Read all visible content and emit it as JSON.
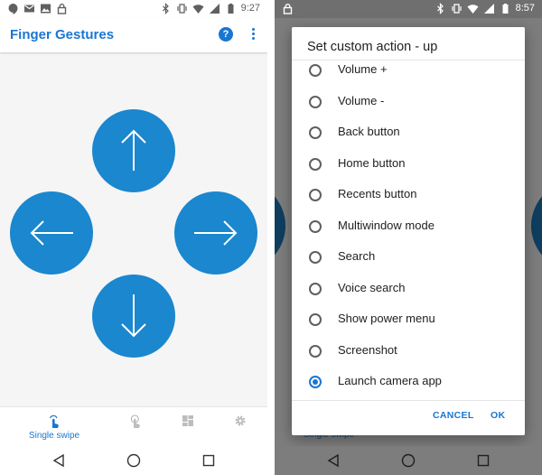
{
  "left_screen": {
    "status_bar": {
      "time": "9:27",
      "left_icons": [
        "hangouts-icon",
        "gmail-icon",
        "image-icon",
        "lock-icon"
      ],
      "right_icons": [
        "bluetooth-icon",
        "vibrate-icon",
        "wifi-icon",
        "signal-icon",
        "battery-icon"
      ]
    },
    "app_bar": {
      "title": "Finger Gestures",
      "icons": [
        "help-icon",
        "more-vert-icon"
      ]
    },
    "gesture_buttons": [
      "arrow-up-icon",
      "arrow-left-icon",
      "arrow-right-icon",
      "arrow-down-icon"
    ],
    "bottom_tabs": [
      {
        "label": "Single swipe",
        "icon": "swipe-icon",
        "selected": true
      },
      {
        "label": "",
        "icon": "double-touch-icon",
        "selected": false
      },
      {
        "label": "",
        "icon": "dashboard-icon",
        "selected": false
      },
      {
        "label": "",
        "icon": "settings-icon",
        "selected": false
      }
    ],
    "nav_bar": [
      "back-icon",
      "home-icon",
      "recents-icon"
    ]
  },
  "right_screen": {
    "status_bar": {
      "time": "8:57",
      "left_icons": [
        "lock-icon"
      ],
      "right_icons": [
        "bluetooth-icon",
        "vibrate-icon",
        "wifi-icon",
        "signal-icon",
        "battery-icon"
      ]
    },
    "background_tab_label": "Single swipe",
    "dialog": {
      "title": "Set custom action - up",
      "options": [
        {
          "label": "Volume +",
          "selected": false
        },
        {
          "label": "Volume -",
          "selected": false
        },
        {
          "label": "Back button",
          "selected": false
        },
        {
          "label": "Home button",
          "selected": false
        },
        {
          "label": "Recents button",
          "selected": false
        },
        {
          "label": "Multiwindow mode",
          "selected": false
        },
        {
          "label": "Search",
          "selected": false
        },
        {
          "label": "Voice search",
          "selected": false
        },
        {
          "label": "Show power menu",
          "selected": false
        },
        {
          "label": "Screenshot",
          "selected": false
        },
        {
          "label": "Launch camera app",
          "selected": true
        }
      ],
      "cancel_label": "CANCEL",
      "ok_label": "OK"
    },
    "nav_bar": [
      "back-icon",
      "home-icon",
      "recents-icon"
    ]
  },
  "colors": {
    "accent": "#1976d2",
    "gesture_circle": "#1a87cf",
    "scrim": "#7d7d7d"
  }
}
